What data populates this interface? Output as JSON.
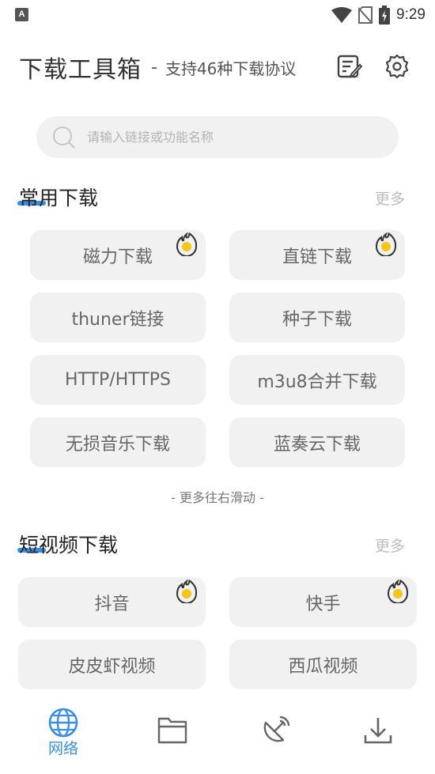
{
  "status_bar": {
    "time": "9:29",
    "app_icon_letter": "A"
  },
  "header": {
    "title": "下载工具箱",
    "separator": "-",
    "subtitle": "支持46种下载协议"
  },
  "search": {
    "placeholder": "请输入链接或功能名称"
  },
  "sections": {
    "common": {
      "title": "常用下载",
      "more": "更多",
      "tiles": [
        "磁力下载",
        "直链下载",
        "thuner链接",
        "种子下载",
        "HTTP/HTTPS",
        "m3u8合并下载",
        "无损音乐下载",
        "蓝奏云下载"
      ],
      "hint": "- 更多往右滑动 -"
    },
    "short_video": {
      "title": "短视频下载",
      "more": "更多",
      "tiles": [
        "抖音",
        "快手",
        "皮皮虾视频",
        "西瓜视频"
      ]
    }
  },
  "bottom_nav": {
    "web_label": "网络"
  },
  "colors": {
    "accent": "#3a8ee6",
    "tile_bg": "#f1f1f1",
    "hot": "#f5c518"
  }
}
